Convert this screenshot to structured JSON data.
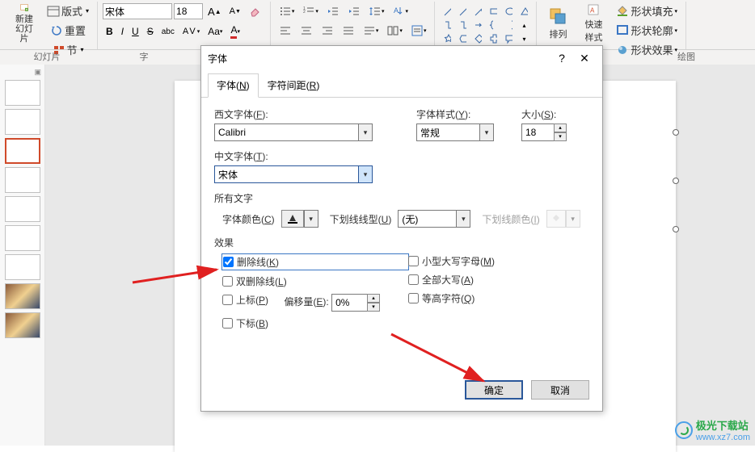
{
  "ribbon": {
    "new_slide": "新建\n幻灯片",
    "layout": "版式",
    "reset": "重置",
    "section": "节",
    "font_name": "宋体",
    "font_size": "18",
    "arrange": "排列",
    "quick_style": "快速样式",
    "shape_fill": "形状填充",
    "shape_outline": "形状轮廓",
    "shape_effects": "形状效果"
  },
  "sections": {
    "slides": "幻灯片",
    "font": "字",
    "drawing": "绘图"
  },
  "dialog": {
    "title": "字体",
    "tab_font": "字体(N)",
    "tab_spacing": "字符间距(R)",
    "western_font_label": "西文字体(F):",
    "western_font_value": "Calibri",
    "font_style_label": "字体样式(Y):",
    "font_style_value": "常规",
    "size_label": "大小(S):",
    "size_value": "18",
    "chinese_font_label": "中文字体(T):",
    "chinese_font_value": "宋体",
    "all_text": "所有文字",
    "font_color": "字体颜色(C)",
    "underline_type": "下划线线型(U)",
    "underline_value": "(无)",
    "underline_color": "下划线颜色(I)",
    "effects": "效果",
    "strike": "删除线(K)",
    "dbl_strike": "双删除线(L)",
    "superscript": "上标(P)",
    "offset_label": "偏移量(E):",
    "offset_value": "0%",
    "subscript": "下标(B)",
    "small_caps": "小型大写字母(M)",
    "all_caps": "全部大写(A)",
    "equalize": "等高字符(Q)",
    "ok": "确定",
    "cancel": "取消"
  },
  "watermark": {
    "name": "极光下载站",
    "url": "www.xz7.com"
  }
}
